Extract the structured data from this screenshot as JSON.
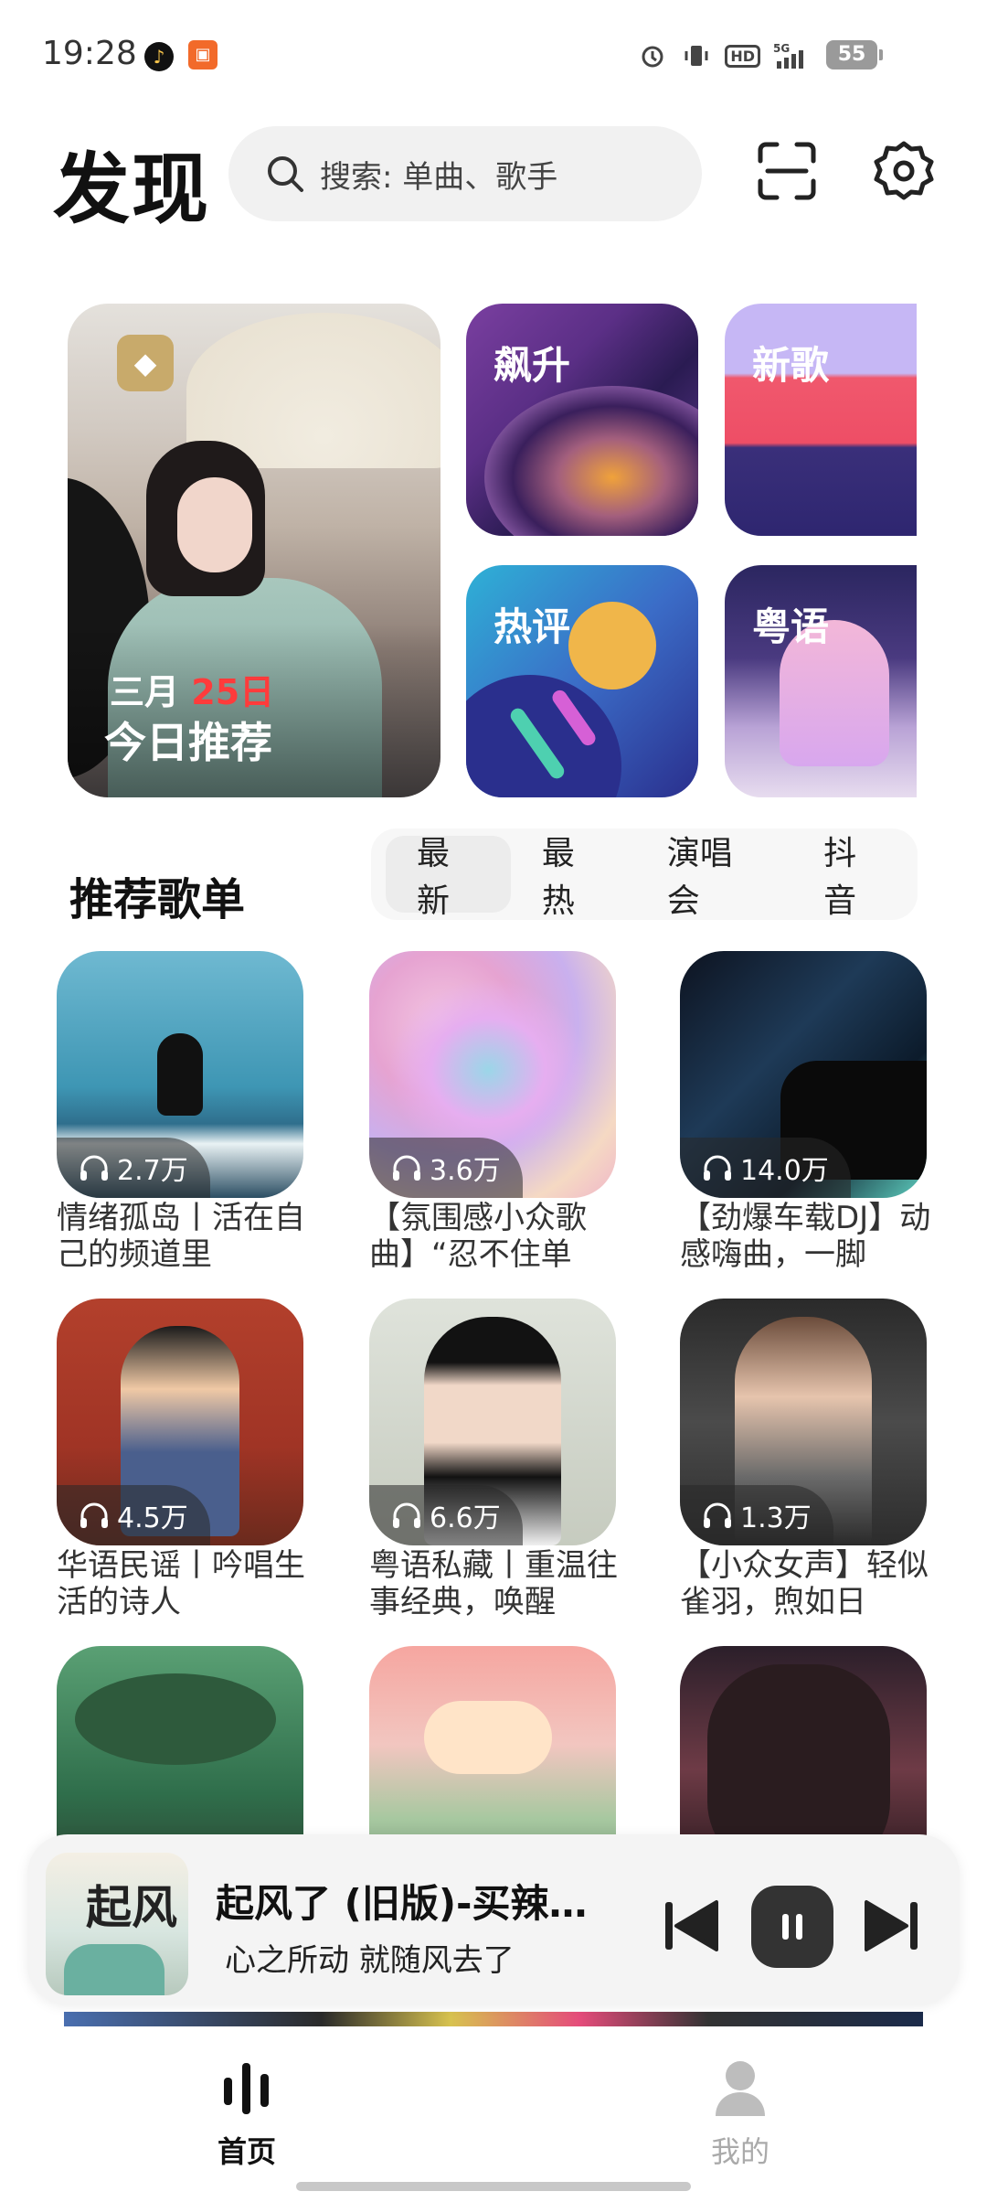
{
  "status_bar": {
    "time": "19:28",
    "network": "5G",
    "hd": "HD",
    "battery": "55"
  },
  "header": {
    "title": "发现",
    "search_placeholder": "搜索: 单曲、歌手"
  },
  "featured": {
    "daily": {
      "month": "三月",
      "day": "25日",
      "title": "今日推荐"
    },
    "tiles": [
      "飙升",
      "新歌",
      "热评",
      "粤语"
    ]
  },
  "playlists": {
    "section_title": "推荐歌单",
    "tabs": [
      "最新",
      "最热",
      "演唱会",
      "抖音"
    ],
    "active_tab": "最新",
    "items": [
      {
        "plays": "2.7万",
        "title": "情绪孤岛丨活在自己的频道里"
      },
      {
        "plays": "3.6万",
        "title": "【氛围感小众歌曲】“忍不住单"
      },
      {
        "plays": "14.0万",
        "title": "【劲爆车载DJ】动感嗨曲，一脚"
      },
      {
        "plays": "4.5万",
        "title": "华语民谣丨吟唱生活的诗人"
      },
      {
        "plays": "6.6万",
        "title": "粤语私藏丨重温往事经典，唤醒"
      },
      {
        "plays": "1.3万",
        "title": "【小众女声】轻似雀羽，煦如日"
      },
      {
        "plays": "",
        "title": ""
      },
      {
        "plays": "",
        "title": ""
      },
      {
        "plays": "",
        "title": ""
      }
    ]
  },
  "player": {
    "song": "起风了 (旧版)-买辣椒也用券",
    "song_display": "起风了 (旧版)-买辣…",
    "lyric": "心之所动 就随风去了",
    "art_text": "起风"
  },
  "nav": {
    "home": "首页",
    "me": "我的"
  }
}
